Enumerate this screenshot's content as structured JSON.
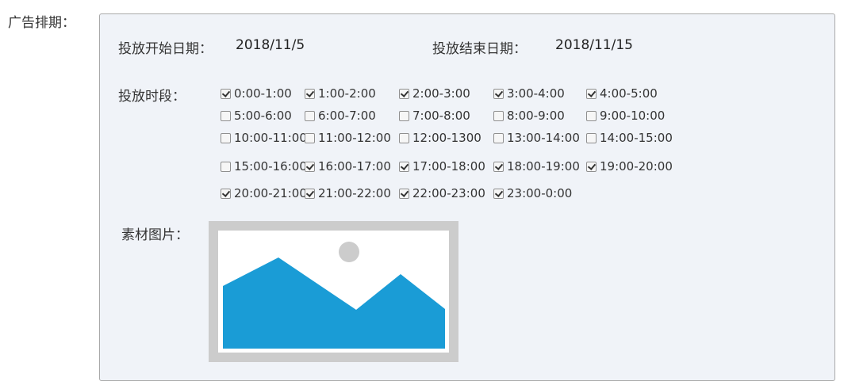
{
  "ad_schedule": {
    "section_label": "广告排期：",
    "start_label": "投放开始日期：",
    "start_value": "2018/11/5",
    "end_label": "投放结束日期：",
    "end_value": "2018/11/15",
    "time_label": "投放时段：",
    "image_label": "素材图片：",
    "time_slots": [
      {
        "label": "0:00-1:00",
        "checked": true
      },
      {
        "label": "1:00-2:00",
        "checked": true
      },
      {
        "label": "2:00-3:00",
        "checked": true
      },
      {
        "label": "3:00-4:00",
        "checked": true
      },
      {
        "label": "4:00-5:00",
        "checked": true
      },
      {
        "label": "5:00-6:00",
        "checked": false
      },
      {
        "label": "6:00-7:00",
        "checked": false
      },
      {
        "label": "7:00-8:00",
        "checked": false
      },
      {
        "label": "8:00-9:00",
        "checked": false
      },
      {
        "label": "9:00-10:00",
        "checked": false
      },
      {
        "label": "10:00-11:00",
        "checked": false
      },
      {
        "label": "11:00-12:00",
        "checked": false
      },
      {
        "label": "12:00-1300",
        "checked": false
      },
      {
        "label": "13:00-14:00",
        "checked": false
      },
      {
        "label": "14:00-15:00",
        "checked": false
      },
      {
        "label": "15:00-16:00",
        "checked": false
      },
      {
        "label": "16:00-17:00",
        "checked": true
      },
      {
        "label": "17:00-18:00",
        "checked": true
      },
      {
        "label": "18:00-19:00",
        "checked": true
      },
      {
        "label": "19:00-20:00",
        "checked": true
      },
      {
        "label": "20:00-21:00",
        "checked": true
      },
      {
        "label": "21:00-22:00",
        "checked": true
      },
      {
        "label": "22:00-23:00",
        "checked": true
      },
      {
        "label": "23:00-0:00",
        "checked": true
      }
    ],
    "image_icon": "image-placeholder-icon",
    "colors": {
      "panel_bg": "#f0f3f8",
      "panel_border": "#a9a9a9",
      "image_frame": "#cccccc",
      "mountain": "#1a9cd6",
      "sun": "#cccccc"
    }
  }
}
